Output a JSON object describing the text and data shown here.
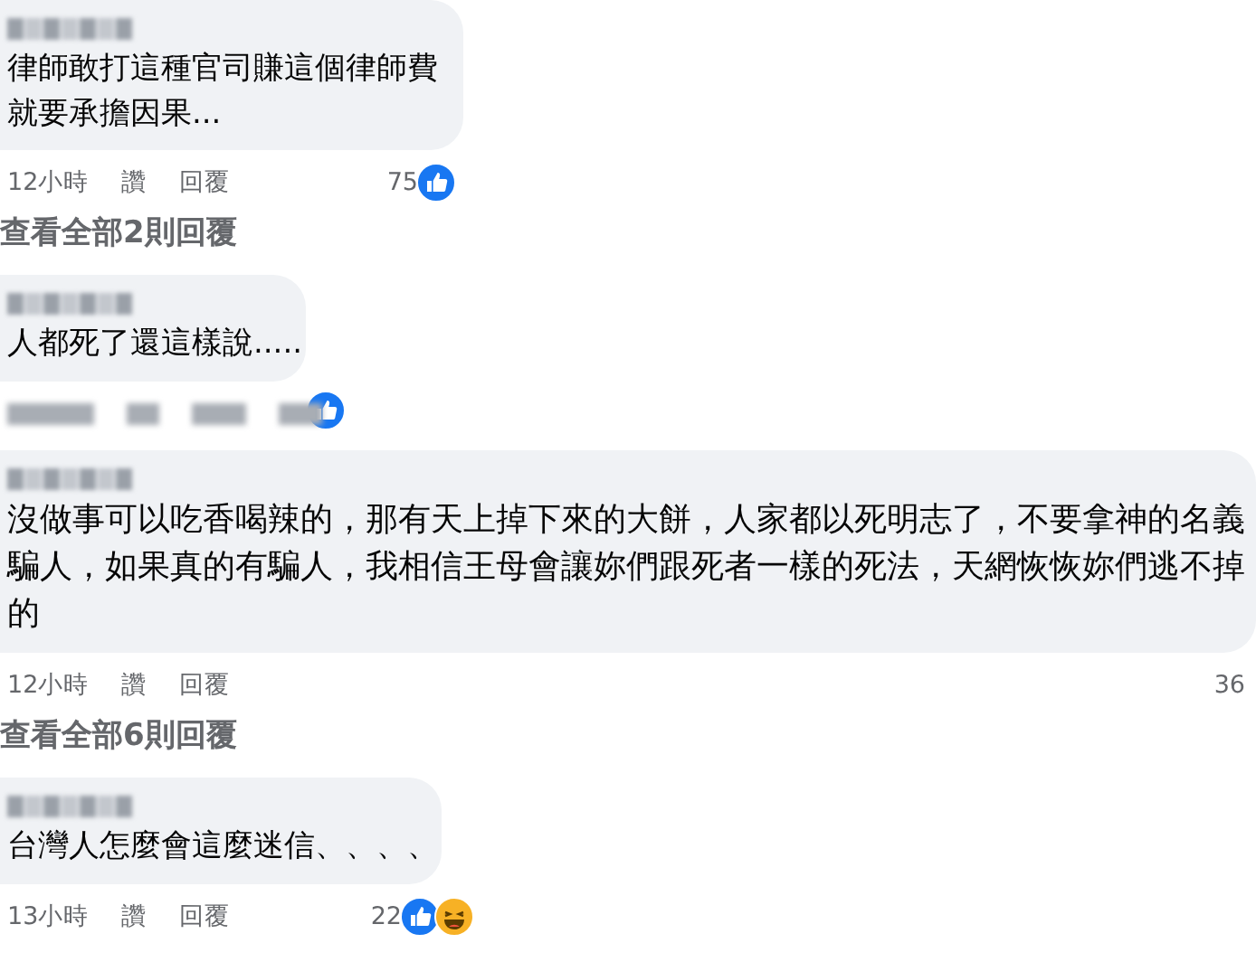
{
  "comments": [
    {
      "text": "律師敢打這種官司賺這個律師費就要承擔因果...",
      "meta_blurred": false,
      "time": "12小時",
      "actions": [
        "讚",
        "回覆"
      ],
      "likes": "75",
      "reactions": [
        {
          "kind": "like"
        }
      ],
      "view_replies": "查看全部2則回覆"
    },
    {
      "text": "人都死了還這樣說.....",
      "meta_blurred": true,
      "reactions": [
        {
          "kind": "like"
        }
      ]
    },
    {
      "text": "沒做事可以吃香喝辣的，那有天上掉下來的大餅，人家都以死明志了，不要拿神的名義騙人，如果真的有騙人，我相信王母會讓妳們跟死者一樣的死法，天網恢恢妳們逃不掉的",
      "meta_blurred": false,
      "time": "12小時",
      "actions": [
        "讚",
        "回覆"
      ],
      "likes": "36",
      "view_replies": "查看全部6則回覆"
    },
    {
      "text": "台灣人怎麼會這麼迷信、、、、",
      "meta_blurred": false,
      "time": "13小時",
      "actions": [
        "讚",
        "回覆"
      ],
      "likes": "22",
      "reactions": [
        {
          "kind": "like"
        },
        {
          "kind": "haha"
        }
      ]
    }
  ]
}
